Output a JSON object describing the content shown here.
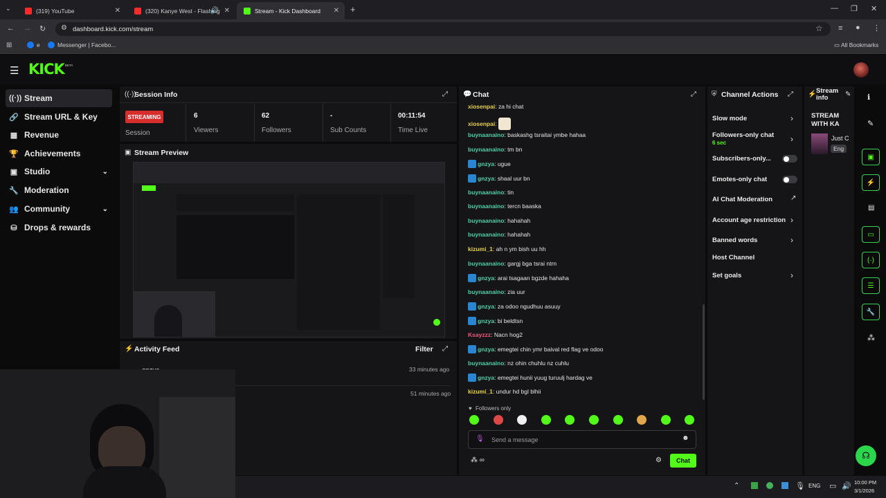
{
  "browser": {
    "tabs": [
      {
        "title": "(319) YouTube"
      },
      {
        "title": "(320) Kanye West - Flashing"
      },
      {
        "title": "Stream - Kick Dashboard"
      }
    ],
    "url": "dashboard.kick.com/stream",
    "bookmarks": [
      {
        "label": "e"
      },
      {
        "label": "Messenger | Facebo..."
      }
    ],
    "all_bookmarks": "All Bookmarks"
  },
  "brand": {
    "logo": "KICK",
    "beta": "BETA"
  },
  "sidebar": {
    "items": [
      {
        "label": "Stream",
        "icon": "broadcast-icon"
      },
      {
        "label": "Stream URL & Key",
        "icon": "link-icon"
      },
      {
        "label": "Revenue",
        "icon": "revenue-icon"
      },
      {
        "label": "Achievements",
        "icon": "trophy-icon"
      },
      {
        "label": "Studio",
        "icon": "studio-icon"
      },
      {
        "label": "Moderation",
        "icon": "wrench-icon"
      },
      {
        "label": "Community",
        "icon": "community-icon"
      },
      {
        "label": "Drops & rewards",
        "icon": "drops-icon"
      }
    ]
  },
  "session": {
    "title": "Session Info",
    "badge": "STREAMING",
    "session_label": "Session",
    "stats": [
      {
        "value": "6",
        "label": "Viewers"
      },
      {
        "value": "62",
        "label": "Followers"
      },
      {
        "value": "-",
        "label": "Sub Counts"
      },
      {
        "value": "00:11:54",
        "label": "Time Live"
      }
    ]
  },
  "preview": {
    "title": "Stream Preview"
  },
  "activity": {
    "title": "Activity Feed",
    "filter": "Filter",
    "items": [
      {
        "user": "gnzya",
        "time": "33 minutes ago"
      },
      {
        "user": "",
        "time": "51 minutes ago"
      }
    ]
  },
  "chat": {
    "title": "Chat",
    "messages": [
      {
        "user": "xiosenpai",
        "text": "za hi chat",
        "color": "#e8d24a",
        "badge": false
      },
      {
        "user": "xiosenpai",
        "text": "",
        "color": "#e8d24a",
        "badge": false
      },
      {
        "user": "buynaanaino",
        "text": "baskashg tsraitai ymbe hahaa",
        "color": "#4fd1a5",
        "badge": false
      },
      {
        "user": "buynaanaino",
        "text": "tm bn",
        "color": "#4fd1a5",
        "badge": false
      },
      {
        "user": "gnzya",
        "text": "ugue",
        "color": "#4fd1a5",
        "badge": true
      },
      {
        "user": "gnzya",
        "text": "shaal uur bn",
        "color": "#4fd1a5",
        "badge": true
      },
      {
        "user": "buynaanaino",
        "text": "tin",
        "color": "#4fd1a5",
        "badge": false
      },
      {
        "user": "buynaanaino",
        "text": "tercn baaska",
        "color": "#4fd1a5",
        "badge": false
      },
      {
        "user": "buynaanaino",
        "text": "hahahah",
        "color": "#4fd1a5",
        "badge": false
      },
      {
        "user": "buynaanaino",
        "text": "hahahah",
        "color": "#4fd1a5",
        "badge": false
      },
      {
        "user": "kizumi_1",
        "text": "ah n ym bish uu hh",
        "color": "#e8d24a",
        "badge": false
      },
      {
        "user": "buynaanaino",
        "text": "gargj bga tsrai ntrn",
        "color": "#4fd1a5",
        "badge": false
      },
      {
        "user": "gnzya",
        "text": "arai tsagaan bgzde hahaha",
        "color": "#4fd1a5",
        "badge": true
      },
      {
        "user": "buynaanaino",
        "text": "zia uur",
        "color": "#4fd1a5",
        "badge": false
      },
      {
        "user": "gnzya",
        "text": "za odoo ngudhuu asuuy",
        "color": "#4fd1a5",
        "badge": true
      },
      {
        "user": "gnzya",
        "text": "bi beldtsn",
        "color": "#4fd1a5",
        "badge": true
      },
      {
        "user": "Ksayzzz",
        "text": "Nacn hog2",
        "color": "#ee5a7a",
        "badge": false
      },
      {
        "user": "gnzya",
        "text": "emegtei chin ymr baival red flag ve odoo",
        "color": "#4fd1a5",
        "badge": true
      },
      {
        "user": "buynaanaino",
        "text": "nz ohin chuhlu nz cuhlu",
        "color": "#4fd1a5",
        "badge": false
      },
      {
        "user": "gnzya",
        "text": "emegtei hunii yuug turuulj hardag ve",
        "color": "#4fd1a5",
        "badge": true
      },
      {
        "user": "kizumi_1",
        "text": "undur hd bgl blhii",
        "color": "#e8d24a",
        "badge": false
      }
    ],
    "followers_only": "Followers only",
    "placeholder": "Send a message",
    "send": "Chat"
  },
  "channel_actions": {
    "title": "Channel Actions",
    "items": [
      {
        "label": "Slow mode",
        "control": "chevron"
      },
      {
        "label": "Followers-only chat",
        "sub": "6 sec",
        "control": "chevron"
      },
      {
        "label": "Subscribers-only...",
        "control": "toggle"
      },
      {
        "label": "Emotes-only chat",
        "control": "toggle"
      },
      {
        "label": "AI Chat Moderation",
        "control": "external"
      },
      {
        "label": "Account age restriction",
        "control": "chevron"
      },
      {
        "label": "Banned words",
        "control": "chevron"
      },
      {
        "label": "Host Channel",
        "control": "none"
      },
      {
        "label": "Set goals",
        "control": "chevron"
      }
    ]
  },
  "stream_info": {
    "title": "Stream info",
    "stream_title": "STREAM WITH KA",
    "category": "Just C",
    "language": "Eng"
  },
  "taskbar": {
    "lang": "ENG",
    "time": "10:00 PM",
    "date": "3/1/2026"
  },
  "colors": {
    "accent": "#53fc18",
    "live": "#d72d2d"
  }
}
